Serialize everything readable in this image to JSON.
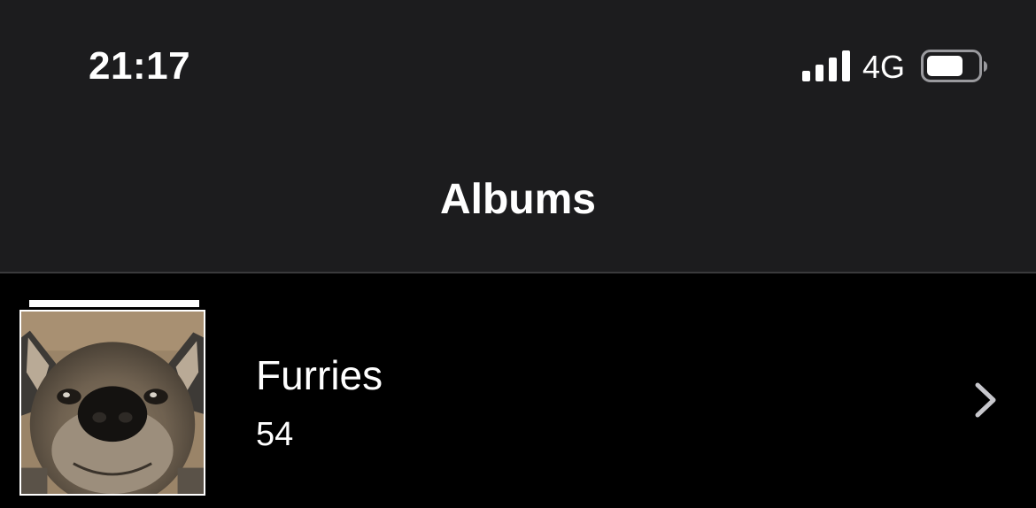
{
  "status_bar": {
    "time": "21:17",
    "network": "4G",
    "signal_icon": "cellular-signal-icon",
    "battery_icon": "battery-icon",
    "battery_level": 0.7
  },
  "nav": {
    "title": "Albums"
  },
  "albums": [
    {
      "name": "Furries",
      "count": "54",
      "thumbnail_icon": "album-thumbnail-image",
      "chevron_icon": "chevron-right-icon"
    }
  ],
  "colors": {
    "header_bg": "#1c1c1e",
    "body_bg": "#000000",
    "divider": "#3a3a3c",
    "text": "#ffffff",
    "chevron": "#c7c7cc"
  }
}
